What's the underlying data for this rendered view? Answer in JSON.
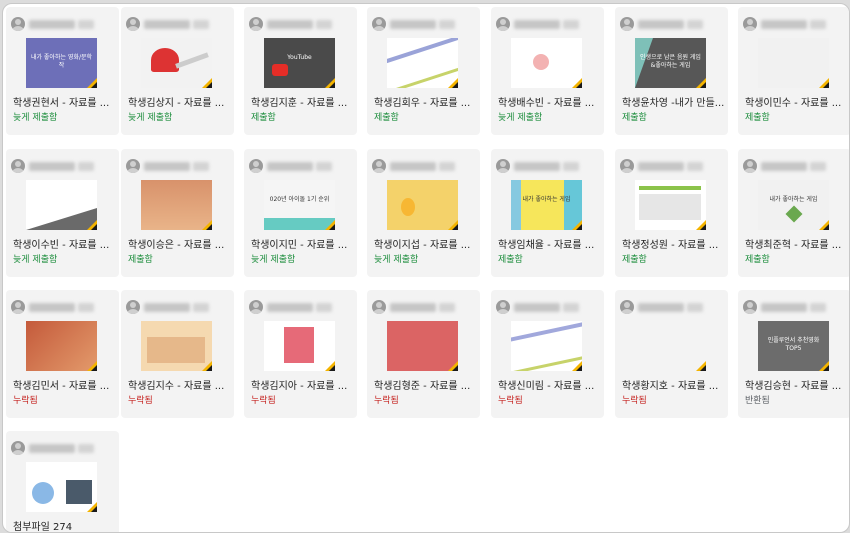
{
  "colors": {
    "late": "#1e8e3e",
    "done": "#1e8e3e",
    "missing": "#c5221f",
    "returned": "#5f6368"
  },
  "rows": [
    [
      {
        "title": "학생권현서 - 자료를 ...",
        "status": "늦게 제출함",
        "thumb": "purple",
        "thumb_text": "내가 좋아하는 영화/문학작"
      },
      {
        "title": "학생김상지 - 자료를 ...",
        "status": "늦게 제출함",
        "thumb": "baseball",
        "thumb_text": ""
      },
      {
        "title": "학생김지훈 - 자료를 ...",
        "status": "제출함",
        "thumb": "youtube",
        "thumb_text": "YouTube"
      },
      {
        "title": "학생김회우 - 자료를 ...",
        "status": "제출함",
        "thumb": "stripe",
        "thumb_text": ""
      },
      {
        "title": "학생배수빈 - 자료를 ...",
        "status": "늦게 제출함",
        "thumb": "pink",
        "thumb_text": ""
      },
      {
        "title": "학생윤차영 -내가 만들...",
        "status": "제출함",
        "thumb": "dark",
        "thumb_text": "인생으로 남은 음원 게임&좋아하는 게임"
      },
      {
        "title": "학생이민수 - 자료를 ...",
        "status": "제출함",
        "thumb": "plain",
        "thumb_text": ""
      }
    ],
    [
      {
        "title": "학생이수빈 - 자료를 ...",
        "status": "늦게 제출함",
        "thumb": "white",
        "thumb_text": ""
      },
      {
        "title": "학생이승은 - 자료를 ...",
        "status": "제출함",
        "thumb": "sunset",
        "thumb_text": ""
      },
      {
        "title": "학생이지민 - 자료를 ...",
        "status": "늦게 제출함",
        "thumb": "ranking",
        "thumb_text": "020년 아이돌 1기 순위"
      },
      {
        "title": "학생이지섭 - 자료를 ...",
        "status": "늦게 제출함",
        "thumb": "yellow",
        "thumb_text": ""
      },
      {
        "title": "학생임채율 - 자료를 ...",
        "status": "제출함",
        "thumb": "game",
        "thumb_text": "내가 좋아하는 게임"
      },
      {
        "title": "학생정성원 - 자료를 ...",
        "status": "제출함",
        "thumb": "web",
        "thumb_text": ""
      },
      {
        "title": "학생최준혁 - 자료를 ...",
        "status": "제출함",
        "thumb": "plain2",
        "thumb_text": "내가 좋아하는 게임"
      }
    ],
    [
      {
        "title": "학생김민서 - 자료를 ...",
        "status": "누락됨",
        "thumb": "flowers",
        "thumb_text": ""
      },
      {
        "title": "학생김지수 - 자료를 ...",
        "status": "누락됨",
        "thumb": "cartoon",
        "thumb_text": ""
      },
      {
        "title": "학생김지아 - 자료를 ...",
        "status": "누락됨",
        "thumb": "pinkbox",
        "thumb_text": ""
      },
      {
        "title": "학생김형준 - 자료를 ...",
        "status": "누락됨",
        "thumb": "red",
        "thumb_text": ""
      },
      {
        "title": "학생신미림 - 자료를 ...",
        "status": "누락됨",
        "thumb": "stripe2",
        "thumb_text": ""
      },
      {
        "title": "학생황지호 - 자료를 ...",
        "status": "누락됨",
        "thumb": "plain3",
        "thumb_text": ""
      },
      {
        "title": "학생김승현 - 자료를 ...",
        "status": "반환됨",
        "thumb": "gray",
        "thumb_text": "인플루언서 추천영화 TOP5"
      }
    ],
    [
      {
        "title": "첨부파일 274",
        "status": "",
        "thumb": "collage",
        "thumb_text": ""
      }
    ]
  ]
}
